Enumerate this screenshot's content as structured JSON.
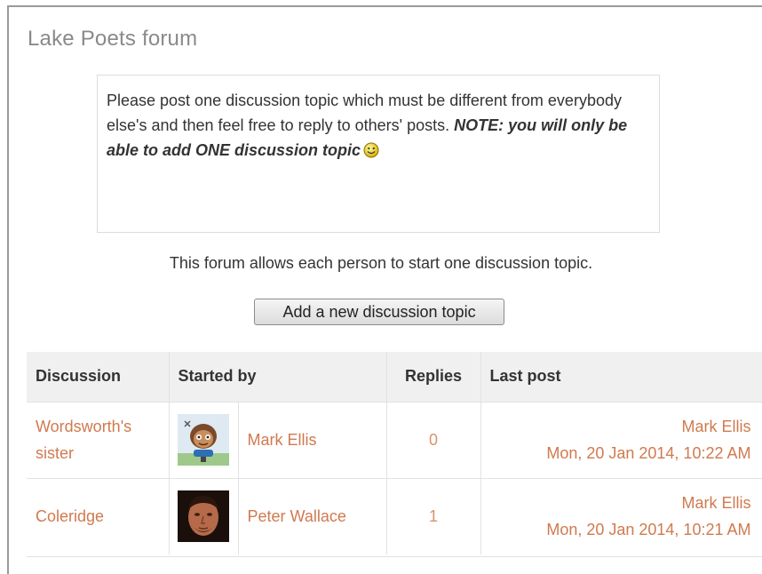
{
  "forum": {
    "title": "Lake Poets forum",
    "intro_text": "Please post one discussion topic which must be different from everybody else's and then feel free to reply to others' posts. ",
    "intro_note": "NOTE: you will only be able to add ONE discussion topic",
    "intro_icon": "smiley-icon",
    "description": "This forum allows each person to start one discussion topic.",
    "add_button_label": "Add a new discussion topic"
  },
  "table": {
    "headers": {
      "discussion": "Discussion",
      "started_by": "Started by",
      "replies": "Replies",
      "last_post": "Last post"
    },
    "rows": [
      {
        "discussion": "Wordsworth's sister",
        "avatar_icon": "cartoon-avatar-icon",
        "started_by": "Mark Ellis",
        "replies": "0",
        "last_post_author": "Mark Ellis",
        "last_post_date": "Mon, 20 Jan 2014, 10:22 AM"
      },
      {
        "discussion": "Coleridge",
        "avatar_icon": "photo-avatar-icon",
        "started_by": "Peter Wallace",
        "replies": "1",
        "last_post_author": "Mark Ellis",
        "last_post_date": "Mon, 20 Jan 2014, 10:21 AM"
      }
    ]
  },
  "colors": {
    "link": "#d07a4f",
    "title": "#8a8a8a",
    "header_bg": "#f0f0f0"
  }
}
